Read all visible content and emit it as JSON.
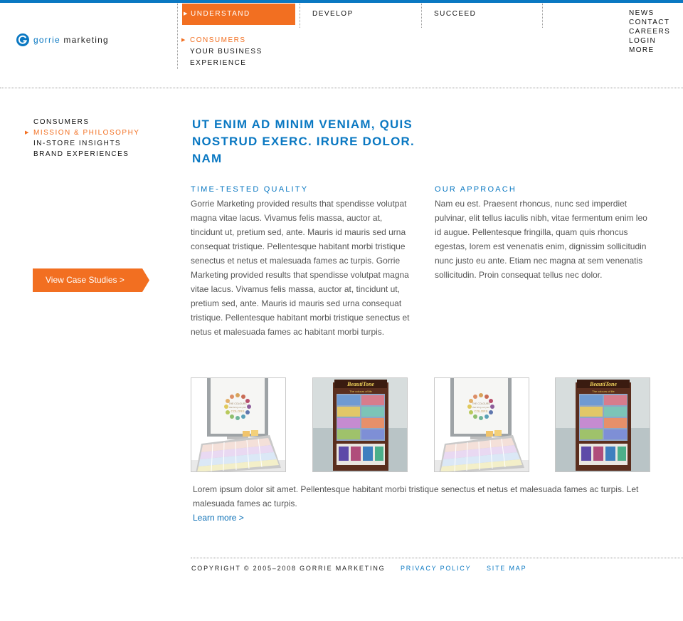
{
  "logo": {
    "brand": "gorrie",
    "rest": " marketing"
  },
  "topnav": [
    {
      "label": "UNDERSTAND",
      "active": true
    },
    {
      "label": "DEVELOP",
      "active": false
    },
    {
      "label": "SUCCEED",
      "active": false
    }
  ],
  "subnav": [
    {
      "label": "CONSUMERS",
      "selected": true
    },
    {
      "label": "YOUR BUSINESS",
      "selected": false
    },
    {
      "label": "EXPERIENCE",
      "selected": false
    }
  ],
  "utility_links": [
    "NEWS",
    "CONTACT",
    "CAREERS",
    "LOGIN",
    "MORE"
  ],
  "sidenav": [
    {
      "label": "CONSUMERS",
      "selected": false
    },
    {
      "label": "MISSION & PHILOSOPHY",
      "selected": true
    },
    {
      "label": "IN-STORE INSIGHTS",
      "selected": false
    },
    {
      "label": "BRAND EXPERIENCES",
      "selected": false
    }
  ],
  "case_button": "View Case Studies >",
  "headline": "UT ENIM AD MINIM VENIAM, QUIS NOSTRUD EXERC. IRURE DOLOR. NAM",
  "columns": [
    {
      "title": "TIME-TESTED QUALITY",
      "body": "Gorrie Marketing provided results that spendisse volutpat magna vitae lacus. Vivamus felis massa, auctor at, tincidunt ut, pretium sed, ante. Mauris id mauris sed urna consequat tristique. Pellentesque habitant morbi tristique senectus et netus et malesuada fames ac turpis. Gorrie Marketing provided results that spendisse volutpat magna vitae lacus. Vivamus felis massa, auctor at, tincidunt ut, pretium sed, ante. Mauris id mauris sed urna consequat tristique. Pellentesque habitant morbi tristique senectus et netus et malesuada fames ac habitant morbi turpis."
    },
    {
      "title": "OUR APPROACH",
      "body": "Nam eu est. Praesent rhoncus, nunc sed imperdiet pulvinar, elit tellus iaculis nibh, vitae fermentum enim leo id augue. Pellentesque fringilla, quam quis rhoncus egestas, lorem est venenatis enim, dignissim sollicitudin nunc justo eu ante. Etiam nec magna at sem venenatis sollicitudin. Proin consequat tellus nec dolor."
    }
  ],
  "thumbnails": [
    {
      "kind": "color-swatch-display",
      "sign_lines": [
        "THE COLOURS",
        "that bring out your",
        "COLORS"
      ]
    },
    {
      "kind": "cosmetics-display",
      "header": "BeautiTone",
      "tagline": "The colours of life"
    },
    {
      "kind": "color-swatch-display",
      "sign_lines": [
        "THE COLOURS",
        "that bring out your",
        "COLORS"
      ]
    },
    {
      "kind": "cosmetics-display",
      "header": "BeautiTone",
      "tagline": "The colours of life"
    }
  ],
  "caption": "Lorem ipsum dolor sit amet. Pellentesque habitant morbi tristique senectus et netus et malesuada fames ac turpis. Let malesuada fames ac turpis.",
  "learn_more": "Learn more >",
  "footer": {
    "copyright": "COPYRIGHT © 2005–2008 GORRIE MARKETING",
    "privacy": "PRIVACY POLICY",
    "sitemap": "SITE MAP"
  },
  "colors": {
    "accent_blue": "#0a78c2",
    "accent_orange": "#f26f21"
  }
}
